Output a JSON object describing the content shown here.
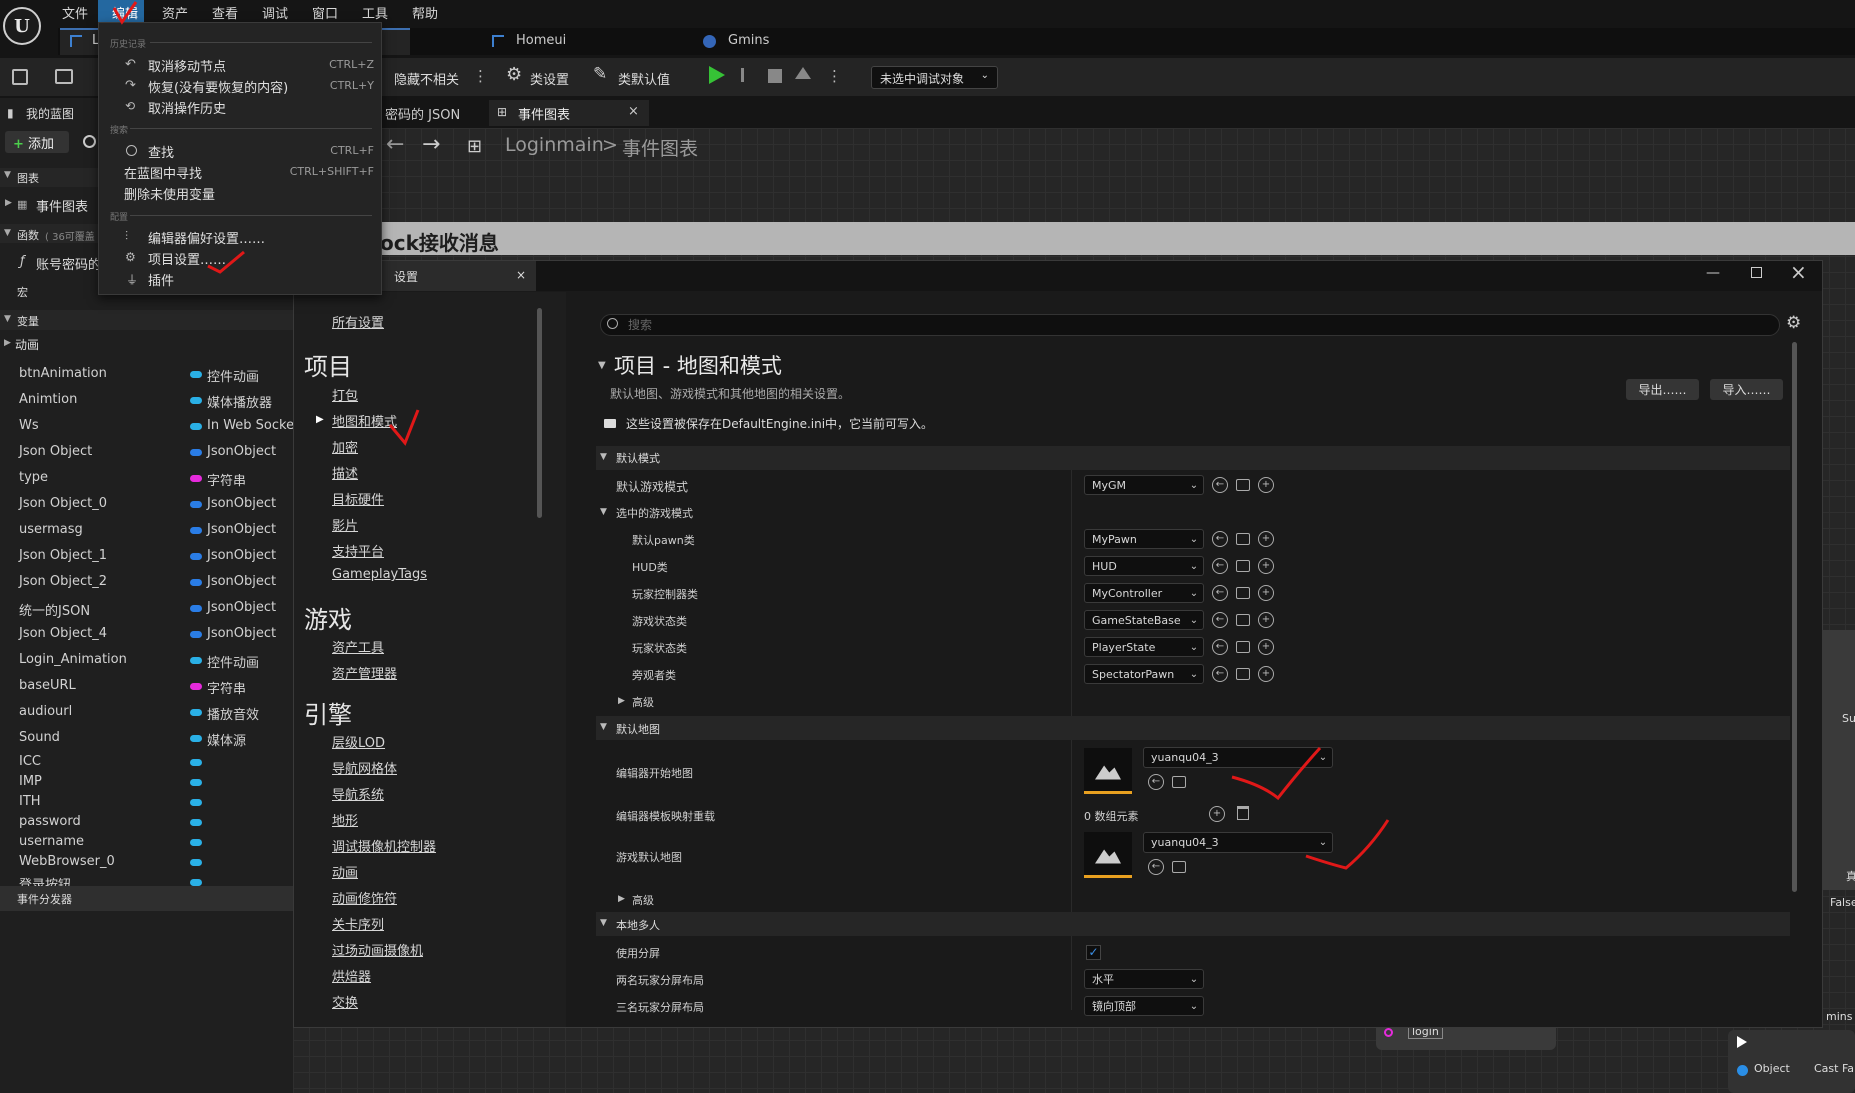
{
  "menubar": {
    "items": [
      "文件",
      "编辑",
      "资产",
      "查看",
      "调试",
      "窗口",
      "工具",
      "帮助"
    ]
  },
  "tabs": {
    "t1": "L",
    "t2": "Homeui",
    "t3": "Gmins"
  },
  "toolbar": {
    "hide_unrelated": "隐藏不相关",
    "class_settings": "类设置",
    "class_defaults": "类默认值",
    "debug_target": "未选中调试对象"
  },
  "doc_tabs": {
    "json": "密码的 JSON",
    "event_graph": "事件图表"
  },
  "breadcrumb": {
    "root": "Loginmain",
    "sep": ">",
    "page": "事件图表"
  },
  "my_blueprint": {
    "title": "我的蓝图",
    "add": "添加",
    "graphs": "图表",
    "event_graph": "事件图表",
    "functions": "函数",
    "func_count": "( 36可覆盖",
    "func_item": "账号密码的",
    "macros": "宏",
    "variables": "变量",
    "anim": "动画",
    "dispatchers": "事件分发器"
  },
  "variables": [
    {
      "name": "btnAnimation",
      "type": "控件动画",
      "color": "#2ab0e6"
    },
    {
      "name": "Animtion",
      "type": "媒体播放器",
      "color": "#2ab0e6"
    },
    {
      "name": "Ws",
      "type": "In Web Socket",
      "color": "#2ab0e6"
    },
    {
      "name": "Json Object",
      "type": "JsonObject",
      "color": "#2a7de6"
    },
    {
      "name": "type",
      "type": "字符串",
      "color": "#e62adc"
    },
    {
      "name": "Json Object_0",
      "type": "JsonObject",
      "color": "#2a7de6"
    },
    {
      "name": "usermasg",
      "type": "JsonObject",
      "color": "#2a7de6"
    },
    {
      "name": "Json Object_1",
      "type": "JsonObject",
      "color": "#2a7de6"
    },
    {
      "name": "Json Object_2",
      "type": "JsonObject",
      "color": "#2a7de6"
    },
    {
      "name": "统一的JSON",
      "type": "JsonObject",
      "color": "#2a7de6"
    },
    {
      "name": "Json Object_4",
      "type": "JsonObject",
      "color": "#2a7de6"
    },
    {
      "name": "Login_Animation",
      "type": "控件动画",
      "color": "#2ab0e6"
    },
    {
      "name": "baseURL",
      "type": "字符串",
      "color": "#e62adc"
    },
    {
      "name": "audiourl",
      "type": "播放音效",
      "color": "#2ab0e6"
    },
    {
      "name": "Sound",
      "type": "媒体源",
      "color": "#2ab0e6"
    },
    {
      "name": "ICC",
      "type": "",
      "color": "#2ab0e6"
    },
    {
      "name": "IMP",
      "type": "",
      "color": "#2ab0e6"
    },
    {
      "name": "ITH",
      "type": "",
      "color": "#2ab0e6"
    },
    {
      "name": "password",
      "type": "",
      "color": "#2ab0e6"
    },
    {
      "name": "username",
      "type": "",
      "color": "#2ab0e6"
    },
    {
      "name": "WebBrowser_0",
      "type": "",
      "color": "#2ab0e6"
    },
    {
      "name": "登录按钮",
      "type": "",
      "color": "#2ab0e6"
    }
  ],
  "edit_menu": {
    "sec_history": "历史记录",
    "undo": "取消移动节点",
    "undo_sc": "CTRL+Z",
    "redo": "恢复(没有要恢复的内容)",
    "redo_sc": "CTRL+Y",
    "undo_history": "取消操作历史",
    "sec_search": "搜索",
    "find": "查找",
    "find_sc": "CTRL+F",
    "find_bp": "在蓝图中寻找",
    "find_bp_sc": "CTRL+SHIFT+F",
    "delete_unused": "删除未使用变量",
    "sec_config": "配置",
    "editor_prefs": "编辑器偏好设置……",
    "project_settings": "项目设置……",
    "plugins": "插件"
  },
  "graph_title": "ock接收消息",
  "project_settings": {
    "tab_title": "设置",
    "search_placeholder": "搜索",
    "all_settings": "所有设置",
    "cat_project": "项目",
    "project_items": [
      "打包",
      "地图和模式",
      "加密",
      "描述",
      "目标硬件",
      "影片",
      "支持平台",
      "GameplayTags"
    ],
    "cat_game": "游戏",
    "game_items": [
      "资产工具",
      "资产管理器"
    ],
    "cat_engine": "引擎",
    "engine_items": [
      "层级LOD",
      "导航网格体",
      "导航系统",
      "地形",
      "调试摄像机控制器",
      "动画",
      "动画修饰符",
      "关卡序列",
      "过场动画摄像机",
      "烘焙器",
      "交换"
    ],
    "section_title": "项目 - 地图和模式",
    "section_desc": "默认地图、游戏模式和其他地图的相关设置。",
    "export": "导出……",
    "import": "导入……",
    "writable_note": "这些设置被保存在DefaultEngine.ini中，它当前可写入。",
    "default_modes": "默认模式",
    "default_game_mode": "默认游戏模式",
    "default_game_mode_val": "MyGM",
    "selected_game_mode": "选中的游戏模式",
    "pawn": "默认pawn类",
    "pawn_val": "MyPawn",
    "hud": "HUD类",
    "hud_val": "HUD",
    "pc": "玩家控制器类",
    "pc_val": "MyController",
    "gs": "游戏状态类",
    "gs_val": "GameStateBase",
    "ps": "玩家状态类",
    "ps_val": "PlayerState",
    "spec": "旁观者类",
    "spec_val": "SpectatorPawn",
    "advanced": "高级",
    "default_maps": "默认地图",
    "editor_start_map": "编辑器开始地图",
    "editor_start_map_val": "yuanqu04_3",
    "editor_template_override": "编辑器模板映射重载",
    "array_count": "0 数组元素",
    "game_default_map": "游戏默认地图",
    "game_default_map_val": "yuanqu04_3",
    "advanced2": "高级",
    "local_mp": "本地多人",
    "use_split": "使用分屏",
    "two_player": "两名玩家分屏布局",
    "two_player_val": "水平",
    "three_player": "三名玩家分屏布局",
    "three_player_val": "镜向顶部"
  },
  "graph_node": {
    "login": "login",
    "object": "Object",
    "cast": "Cast Fa",
    "su": "Su",
    "false": "False",
    "mins": "mins",
    "zhen": "真"
  }
}
